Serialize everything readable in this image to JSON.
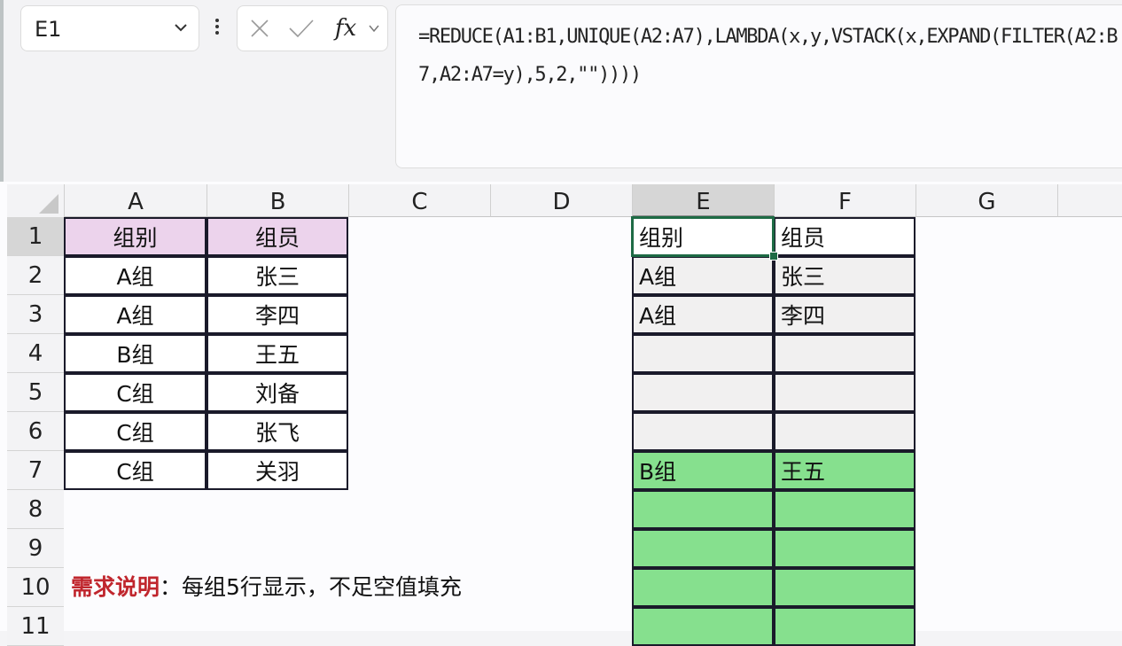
{
  "name_box": {
    "value": "E1"
  },
  "formula_bar": {
    "cancel_icon": "close-icon",
    "enter_icon": "check-icon",
    "function_label": "fx",
    "formula": "=REDUCE(A1:B1,UNIQUE(A2:A7),LAMBDA(x,y,VSTACK(x,EXPAND(FILTER(A2:B7,A2:A7=y),5,2,\"\"))))"
  },
  "columns": [
    "A",
    "B",
    "C",
    "D",
    "E",
    "F",
    "G"
  ],
  "selected_column": "E",
  "rows": [
    "1",
    "2",
    "3",
    "4",
    "5",
    "6",
    "7",
    "8",
    "9",
    "10",
    "11"
  ],
  "source_table": {
    "headers": [
      "组别",
      "组员"
    ],
    "rows": [
      [
        "A组",
        "张三"
      ],
      [
        "A组",
        "李四"
      ],
      [
        "B组",
        "王五"
      ],
      [
        "C组",
        "刘备"
      ],
      [
        "C组",
        "张飞"
      ],
      [
        "C组",
        "关羽"
      ]
    ]
  },
  "result_table": {
    "headers": [
      "组别",
      "组员"
    ],
    "rows": [
      [
        "A组",
        "张三"
      ],
      [
        "A组",
        "李四"
      ],
      [
        "",
        ""
      ],
      [
        "",
        ""
      ],
      [
        "",
        ""
      ],
      [
        "B组",
        "王五"
      ],
      [
        "",
        ""
      ],
      [
        "",
        ""
      ],
      [
        "",
        ""
      ],
      [
        "",
        ""
      ]
    ]
  },
  "colors": {
    "header_fill": "#ecd3ec",
    "group_a_fill": "#f1f0f0",
    "group_b_fill": "#86e08e",
    "selection": "#1e6b45",
    "note_label": "#c0262d"
  },
  "note": {
    "label": "需求说明",
    "separator": "：",
    "text": "每组5行显示，不足空值填充"
  }
}
